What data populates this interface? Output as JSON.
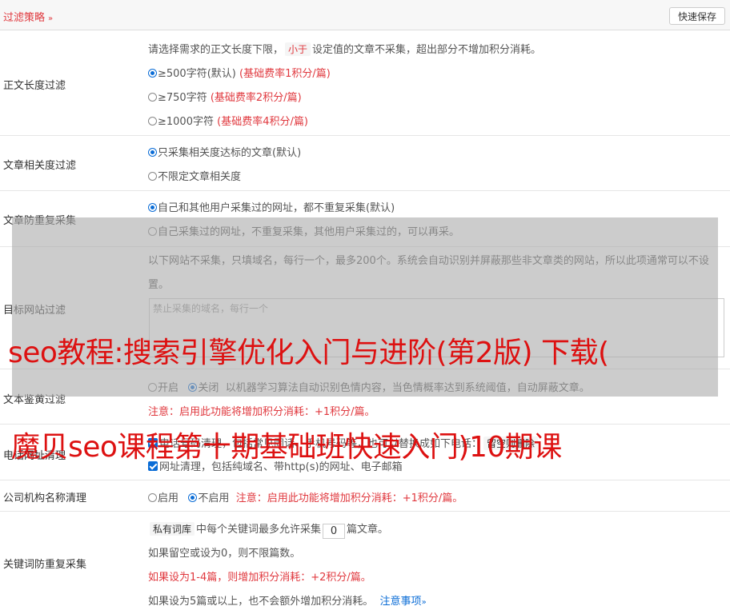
{
  "header": {
    "title": "过滤策略",
    "chevron": "»",
    "save_label": "快速保存"
  },
  "length_filter": {
    "label": "正文长度过滤",
    "desc_before": "请选择需求的正文长度下限，",
    "desc_tag": "小于",
    "desc_after": "设定值的文章不采集，超出部分不增加积分消耗。",
    "options": [
      {
        "text": "≥500字符(默认)",
        "note": "(基础费率1积分/篇)",
        "checked": true
      },
      {
        "text": "≥750字符",
        "note": "(基础费率2积分/篇)",
        "checked": false
      },
      {
        "text": "≥1000字符",
        "note": "(基础费率4积分/篇)",
        "checked": false
      }
    ]
  },
  "relevance": {
    "label": "文章相关度过滤",
    "options": [
      {
        "text": "只采集相关度达标的文章(默认)",
        "checked": true
      },
      {
        "text": "不限定文章相关度",
        "checked": false
      }
    ]
  },
  "dedupe": {
    "label": "文章防重复采集",
    "options": [
      {
        "text": "自己和其他用户采集过的网址，都不重复采集(默认)",
        "checked": true
      },
      {
        "text": "自己采集过的网址，不重复采集，其他用户采集过的，可以再采。",
        "checked": false
      }
    ]
  },
  "target_sites": {
    "label": "目标网站过滤",
    "desc": "以下网站不采集，只填域名，每行一个，最多200个。系统会自动识别并屏蔽那些非文章类的网站，所以此项通常可以不设置。",
    "placeholder": "禁止采集的域名，每行一个"
  },
  "porn_filter": {
    "label": "文本鉴黄过滤",
    "on_label": "开启",
    "off_label": "关闭",
    "desc": "以机器学习算法自动识别色情内容，当色情概率达到系统阈值，自动屏蔽文章。",
    "note": "注意：启用此功能将增加积分消耗：+1积分/篇。"
  },
  "contact_clean": {
    "label": "电话网址清理",
    "phone_text": "电话号码清理，包括常见固话、手机号码等，也可以替换成如下电话：",
    "phone_tag": "留空则删除",
    "url_text": "网址清理，包括纯域名、带http(s)的网址、电子邮箱"
  },
  "org_clean": {
    "label": "公司机构名称清理",
    "enable_label": "启用",
    "disable_label": "不启用",
    "note": "注意：启用此功能将增加积分消耗：+1积分/篇。"
  },
  "keyword_dedupe": {
    "label": "关键词防重复采集",
    "tag": "私有词库",
    "line1_before": "中每个关键词最多允许采集",
    "limit_value": "0",
    "line1_after": "篇文章。",
    "line2": "如果留空或设为0，则不限篇数。",
    "line3": "如果设为1-4篇，则增加积分消耗：+2积分/篇。",
    "line4": "如果设为5篇或以上，也不会额外增加积分消耗。",
    "link": "注意事项",
    "link_chevron": "»"
  },
  "watermark": {
    "line1": "seo教程:搜索引擎优化入门与进阶(第2版) 下载(",
    "line2": "魔贝seo课程第十期基础班快速入门)10期课"
  },
  "colors": {
    "accent": "#e0383e",
    "link": "#0a6cd6",
    "watermark": "#dd1111",
    "overlay": "rgba(170,170,170,0.6)"
  }
}
